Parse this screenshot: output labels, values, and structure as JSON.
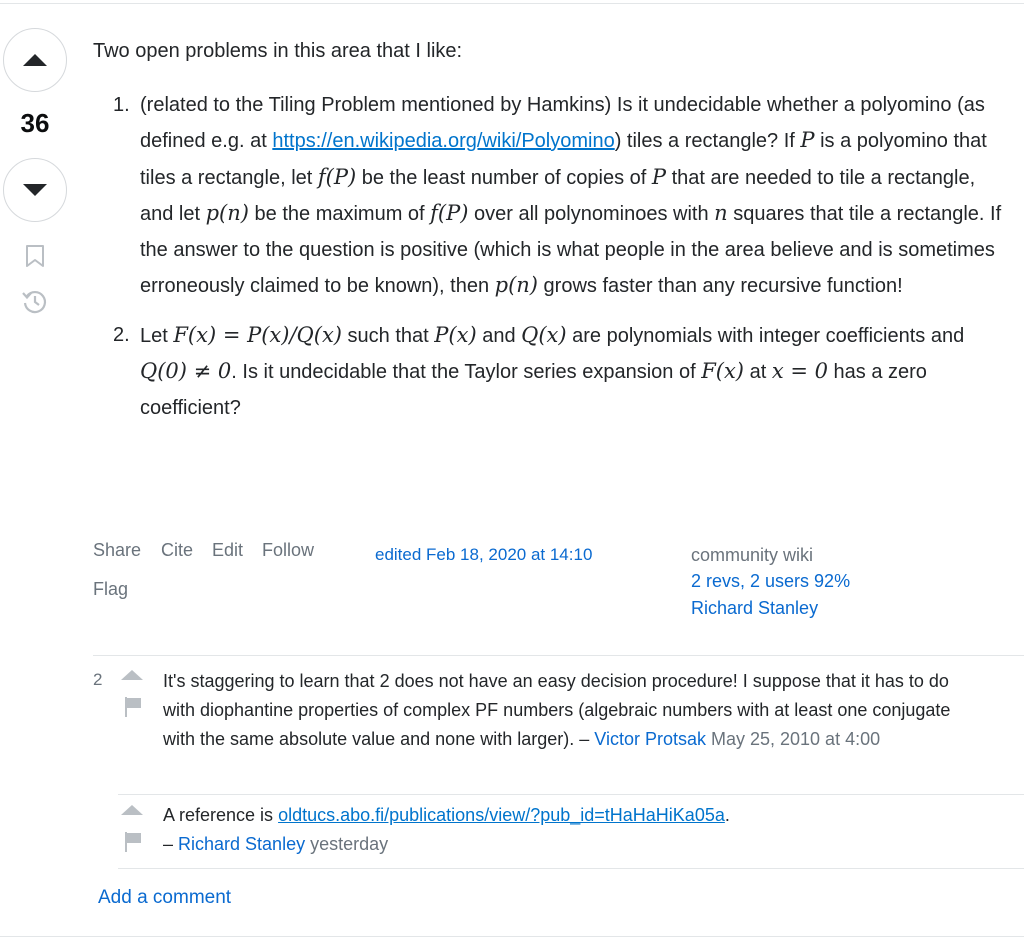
{
  "vote": {
    "score": "36"
  },
  "post": {
    "intro": "Two open problems in this area that I like:",
    "item1": {
      "number": "1.",
      "t1": "(related to the Tiling Problem mentioned by Hamkins) Is it undecidable whether a polyomino (as defined e.g. at ",
      "link": "https://en.wikipedia.org/wiki/Polyomino",
      "t2": ") tiles a rectangle? If ",
      "m1": "P",
      "t3": " is a polyomino that tiles a rectangle, let ",
      "m2": "f(P)",
      "t4": " be the least number of copies of ",
      "m3": "P",
      "t5": " that are needed to tile a rectangle, and let ",
      "m4": "p(n)",
      "t6": " be the maximum of ",
      "m5": "f(P)",
      "t7": " over all polynominoes with ",
      "m6": "n",
      "t8": " squares that tile a rectangle. If the answer to the question is positive (which is what people in the area believe and is sometimes erroneously claimed to be known), then ",
      "m7": "p(n)",
      "t9": " grows faster than any recursive function!"
    },
    "item2": {
      "number": "2.",
      "t1": "Let ",
      "m1": "F(x) = P(x)/Q(x)",
      "t2": " such that ",
      "m2": "P(x)",
      "t3": " and ",
      "m3": "Q(x)",
      "t4": " are polynomials with integer coefficients and ",
      "m4": "Q(0) ≠ 0",
      "t5": ". Is it undecidable that the Taylor series expansion of ",
      "m5": "F(x)",
      "t6": " at ",
      "m6": "x = 0",
      "t7": " has a zero coefficient?"
    }
  },
  "menu": {
    "share": "Share",
    "cite": "Cite",
    "edit": "Edit",
    "follow": "Follow",
    "flag": "Flag"
  },
  "edited": "edited Feb 18, 2020 at 14:10",
  "wiki": {
    "label": "community wiki",
    "revs": "2 revs, 2 users 92%",
    "user": "Richard Stanley"
  },
  "comments": [
    {
      "score": "2",
      "text": "It's staggering to learn that 2 does not have an easy decision procedure! I suppose that it has to do with diophantine properties of complex PF numbers (algebraic numbers with at least one conjugate with the same absolute value and none with larger). – ",
      "user": "Victor Protsak",
      "date": " May 25, 2010 at 4:00"
    },
    {
      "score": "",
      "text": "A reference is ",
      "link": "oldtucs.abo.fi/publications/view/?pub_id=tHaHaHiKa05a",
      "after": ".",
      "dash": "– ",
      "user": "Richard Stanley",
      "date": " yesterday"
    }
  ],
  "add_comment": "Add a comment"
}
